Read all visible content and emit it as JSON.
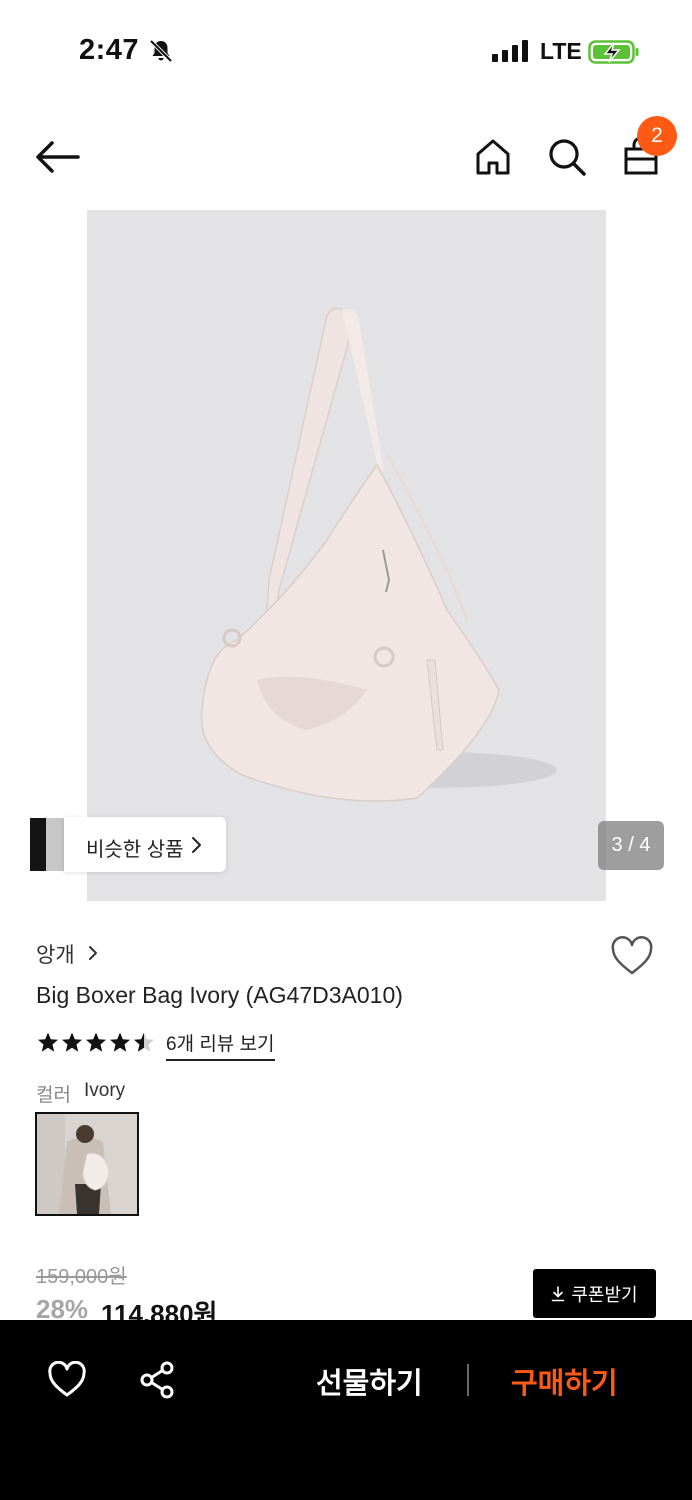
{
  "status_bar": {
    "time": "2:47",
    "network": "LTE",
    "icons": [
      "bell-slash-icon",
      "signal-icon",
      "battery-charging-icon"
    ]
  },
  "nav": {
    "icons": [
      "arrow-left-icon",
      "home-icon",
      "search-icon",
      "shopping-bag-icon"
    ],
    "cart_count": "2"
  },
  "gallery": {
    "similar_label": "비슷한 상품",
    "page_indicator": "3 / 4"
  },
  "product": {
    "brand": "앙개",
    "name": "Big Boxer Bag Ivory (AG47D3A010)",
    "rating": 4.5,
    "review_link": "6개 리뷰 보기",
    "color_label": "컬러",
    "color_value": "Ivory",
    "original_price": "159,000원",
    "discount": "28%",
    "sale_price": "114,880원",
    "coupon_label": "쿠폰받기"
  },
  "bottom_bar": {
    "gift_label": "선물하기",
    "buy_label": "구매하기",
    "accent_color": "#ff5a14"
  }
}
